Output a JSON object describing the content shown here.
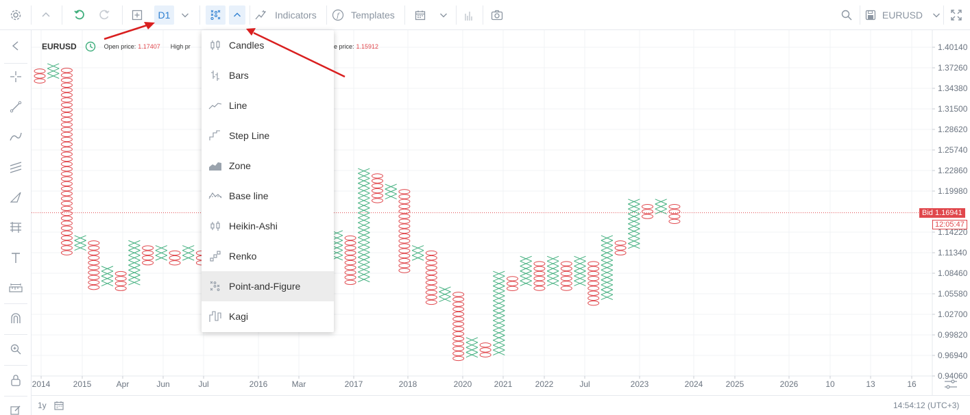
{
  "toolbar": {
    "timeframe": "D1",
    "indicators_label": "Indicators",
    "templates_label": "Templates",
    "symbol": "EURUSD"
  },
  "legend": {
    "symbol": "EURUSD",
    "open_label": "Open price:",
    "open_value": "1.17407",
    "high_label": "High pr",
    "close_label": "e price:",
    "close_value": "1.15912"
  },
  "chart_menu": {
    "items": [
      {
        "label": "Candles",
        "icon": "candles-icon"
      },
      {
        "label": "Bars",
        "icon": "bars-icon"
      },
      {
        "label": "Line",
        "icon": "line-icon"
      },
      {
        "label": "Step Line",
        "icon": "step-line-icon"
      },
      {
        "label": "Zone",
        "icon": "zone-icon"
      },
      {
        "label": "Base line",
        "icon": "base-line-icon"
      },
      {
        "label": "Heikin-Ashi",
        "icon": "heikin-ashi-icon"
      },
      {
        "label": "Renko",
        "icon": "renko-icon"
      },
      {
        "label": "Point-and-Figure",
        "icon": "point-and-figure-icon"
      },
      {
        "label": "Kagi",
        "icon": "kagi-icon"
      }
    ],
    "selected": "Point-and-Figure"
  },
  "price_axis": {
    "labels": [
      "1.40140",
      "1.37260",
      "1.34380",
      "1.31500",
      "1.28620",
      "1.25740",
      "1.22860",
      "1.19980",
      "1.14220",
      "1.11340",
      "1.08460",
      "1.05580",
      "1.02700",
      "0.99820",
      "0.96940",
      "0.94060"
    ]
  },
  "bid": {
    "label": "Bid 1.16941",
    "countdown": "12:05:47"
  },
  "time_axis": {
    "labels": [
      "2014",
      "2015",
      "Apr",
      "Jun",
      "Jul",
      "2016",
      "Mar",
      "2017",
      "2018",
      "2020",
      "2021",
      "2022",
      "Jul",
      "2023",
      "2024",
      "2025",
      "2026",
      "10",
      "13",
      "16"
    ]
  },
  "bottom": {
    "range": "1y",
    "clock": "14:54:12 (UTC+3)"
  },
  "colors": {
    "x_column": "#3fae7c",
    "o_column": "#e0474c",
    "accent": "#2f80d1",
    "annotation_arrow": "#d91f1f"
  },
  "chart_data": {
    "type": "point-and-figure",
    "symbol": "EURUSD",
    "box_size_hint": 0.0072,
    "price_ticks": [
      1.4014,
      1.3726,
      1.3438,
      1.315,
      1.2862,
      1.2574,
      1.2286,
      1.1998,
      1.1422,
      1.1134,
      1.0846,
      1.0558,
      1.027,
      0.9982,
      0.9694,
      0.9406
    ],
    "columns": [
      {
        "t": "O",
        "hi": 1.368,
        "lo": 1.354
      },
      {
        "t": "X",
        "hi": 1.375,
        "lo": 1.361
      },
      {
        "t": "O",
        "hi": 1.369,
        "lo": 1.113
      },
      {
        "t": "X",
        "hi": 1.134,
        "lo": 1.12
      },
      {
        "t": "O",
        "hi": 1.127,
        "lo": 1.062
      },
      {
        "t": "X",
        "hi": 1.091,
        "lo": 1.069
      },
      {
        "t": "O",
        "hi": 1.084,
        "lo": 1.062
      },
      {
        "t": "X",
        "hi": 1.127,
        "lo": 1.069
      },
      {
        "t": "O",
        "hi": 1.12,
        "lo": 1.098
      },
      {
        "t": "X",
        "hi": 1.12,
        "lo": 1.105
      },
      {
        "t": "O",
        "hi": 1.113,
        "lo": 1.098
      },
      {
        "t": "X",
        "hi": 1.12,
        "lo": 1.105
      },
      {
        "t": "O",
        "hi": 1.113,
        "lo": 1.098
      },
      {
        "t": "O",
        "hi": 1.12,
        "lo": 1.048
      },
      {
        "t": "X",
        "hi": 1.091,
        "lo": 1.055
      },
      {
        "t": "O",
        "hi": 1.084,
        "lo": 1.062
      },
      {
        "t": "X",
        "hi": 1.199,
        "lo": 1.069
      },
      {
        "t": "O",
        "hi": 1.192,
        "lo": 1.178
      },
      {
        "t": "X",
        "hi": 1.242,
        "lo": 1.185
      },
      {
        "t": "O",
        "hi": 1.235,
        "lo": 1.141
      },
      {
        "t": "X",
        "hi": 1.163,
        "lo": 1.148
      },
      {
        "t": "O",
        "hi": 1.156,
        "lo": 1.098
      },
      {
        "t": "X",
        "hi": 1.141,
        "lo": 1.105
      },
      {
        "t": "O",
        "hi": 1.134,
        "lo": 1.069
      },
      {
        "t": "X",
        "hi": 1.228,
        "lo": 1.076
      },
      {
        "t": "O",
        "hi": 1.221,
        "lo": 1.185
      },
      {
        "t": "X",
        "hi": 1.206,
        "lo": 1.192
      },
      {
        "t": "O",
        "hi": 1.199,
        "lo": 1.091
      },
      {
        "t": "X",
        "hi": 1.12,
        "lo": 1.105
      },
      {
        "t": "O",
        "hi": 1.113,
        "lo": 1.041
      },
      {
        "t": "X",
        "hi": 1.062,
        "lo": 1.048
      },
      {
        "t": "O",
        "hi": 1.055,
        "lo": 0.962
      },
      {
        "t": "X",
        "hi": 0.991,
        "lo": 0.969
      },
      {
        "t": "O",
        "hi": 0.984,
        "lo": 0.969
      },
      {
        "t": "X",
        "hi": 1.084,
        "lo": 0.976
      },
      {
        "t": "O",
        "hi": 1.077,
        "lo": 1.062
      },
      {
        "t": "X",
        "hi": 1.105,
        "lo": 1.069
      },
      {
        "t": "O",
        "hi": 1.098,
        "lo": 1.062
      },
      {
        "t": "X",
        "hi": 1.105,
        "lo": 1.069
      },
      {
        "t": "O",
        "hi": 1.098,
        "lo": 1.062
      },
      {
        "t": "X",
        "hi": 1.105,
        "lo": 1.069
      },
      {
        "t": "O",
        "hi": 1.098,
        "lo": 1.041
      },
      {
        "t": "X",
        "hi": 1.134,
        "lo": 1.048
      },
      {
        "t": "O",
        "hi": 1.127,
        "lo": 1.113
      },
      {
        "t": "X",
        "hi": 1.185,
        "lo": 1.12
      },
      {
        "t": "O",
        "hi": 1.178,
        "lo": 1.163
      },
      {
        "t": "X",
        "hi": 1.185,
        "lo": 1.17
      },
      {
        "t": "O",
        "hi": 1.178,
        "lo": 1.156
      }
    ]
  }
}
